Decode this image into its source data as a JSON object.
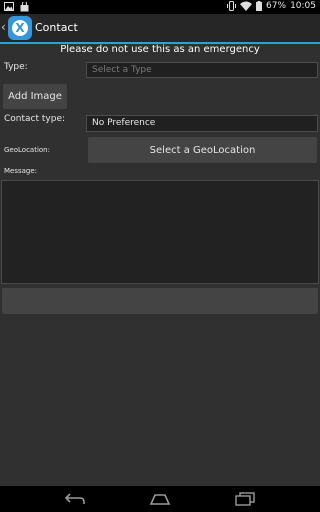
{
  "status_bar": {
    "battery": "67%",
    "time": "10:05",
    "icons": [
      "image-icon",
      "bag-icon",
      "vibrate-icon",
      "wifi-icon",
      "battery-icon"
    ]
  },
  "action_bar": {
    "title": "Contact",
    "app_icon_letter": "X",
    "accent": "#2ea3c9"
  },
  "notice": "Please do not use this as an emergency",
  "form": {
    "type_label": "Type:",
    "type_placeholder": "Select a Type",
    "add_image_label": "Add Image",
    "contact_type_label": "Contact type:",
    "contact_type_value": "No Preference",
    "geolocation_label": "GeoLocation:",
    "geolocation_button": "Select a GeoLocation",
    "message_label": "Message:",
    "message_value": "",
    "submit_label": ""
  },
  "nav_bar": {
    "icons": [
      "back-icon",
      "home-icon",
      "recents-icon"
    ]
  }
}
